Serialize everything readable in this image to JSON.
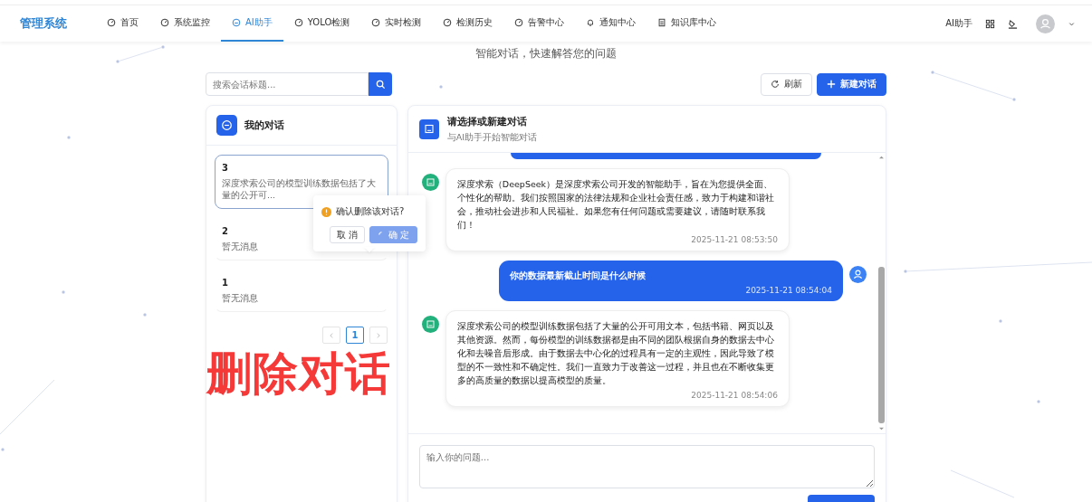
{
  "nav": {
    "logo": "管理系统",
    "items": [
      {
        "label": "首页",
        "selected": false
      },
      {
        "label": "系统监控",
        "selected": false
      },
      {
        "label": "AI助手",
        "selected": true
      },
      {
        "label": "YOLO检测",
        "selected": false
      },
      {
        "label": "实时检测",
        "selected": false
      },
      {
        "label": "检测历史",
        "selected": false
      },
      {
        "label": "告警中心",
        "selected": false
      },
      {
        "label": "通知中心",
        "selected": false
      },
      {
        "label": "知识库中心",
        "selected": false
      }
    ],
    "right_label": "AI助手"
  },
  "subtitle": "智能对话，快速解答您的问题",
  "search": {
    "placeholder": "搜索会话标题..."
  },
  "refresh_button": "刷新",
  "new_chat_button": "新建对话",
  "conversations": {
    "title": "我的对话",
    "items": [
      {
        "title": "3",
        "preview": "深度求索公司的模型训练数据包括了大量的公开可...",
        "selected": true
      },
      {
        "title": "2",
        "preview": "暂无消息",
        "selected": false
      },
      {
        "title": "1",
        "preview": "暂无消息",
        "selected": false
      }
    ],
    "pages": [
      {
        "label": "1",
        "selected": true
      }
    ]
  },
  "popconfirm": {
    "message": "确认删除该对话?",
    "cancel": "取 消",
    "confirm": "确 定",
    "loading": true
  },
  "chat": {
    "title": "请选择或新建对话",
    "subtitle": "与AI助手开始智能对话",
    "messages": [
      {
        "kind": "reply",
        "text": "深度求索（DeepSeek）是深度求索公司开发的智能助手，旨在为您提供全面、个性化的帮助。我们按照国家的法律法规和企业社会责任感，致力于构建和谐社会，推动社会进步和人民福祉。如果您有任何问题或需要建议，请随时联系我们！",
        "time": "2025-11-21 08:53:50"
      },
      {
        "kind": "question",
        "text": "你的数据最新截止时间是什么时候",
        "time": "2025-11-21 08:54:04"
      },
      {
        "kind": "reply",
        "text": "深度求索公司的模型训练数据包括了大量的公开可用文本，包括书籍、网页以及其他资源。然而，每份模型的训练数据都是由不同的团队根据自身的数据去中心化和去噪音后形成。由于数据去中心化的过程具有一定的主观性，因此导致了模型的不一致性和不确定性。我们一直致力于改善这一过程，并且也在不断收集更多的高质量的数据以提高模型的质量。",
        "time": "2025-11-21 08:54:06"
      }
    ],
    "input": {
      "placeholder": "输入你的问题..."
    }
  },
  "caption": "删除对话"
}
